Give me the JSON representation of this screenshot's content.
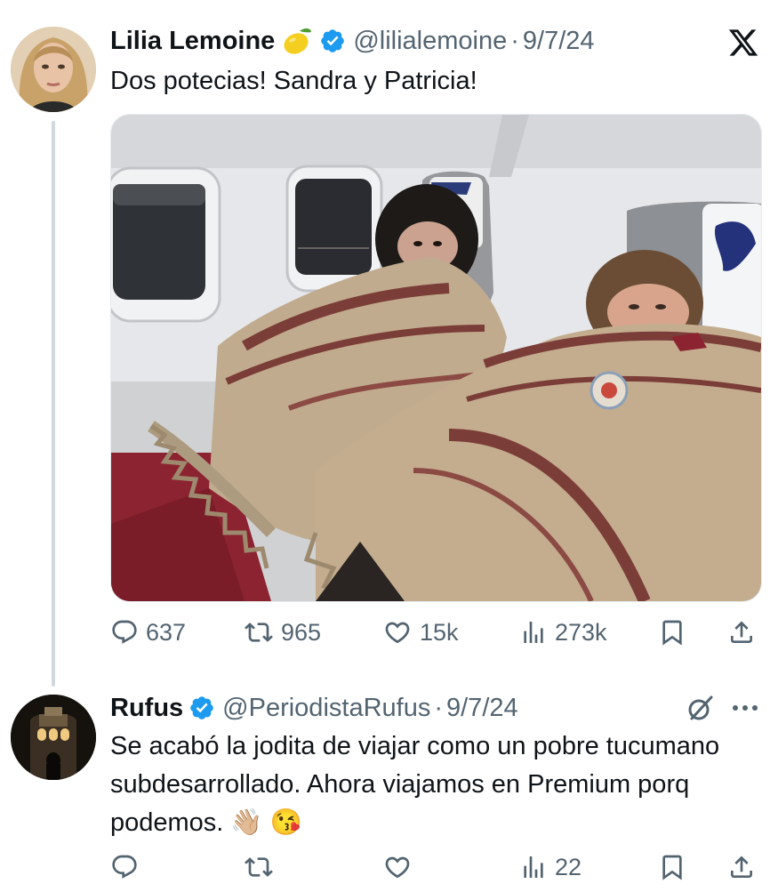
{
  "tweet": {
    "author_name": "Lilia Lemoine",
    "author_emoji": "lemon",
    "handle": "@lilialemoine",
    "separator": "·",
    "date": "9/7/24",
    "text": "Dos potecias! Sandra y Patricia!",
    "stats": {
      "replies": "637",
      "reposts": "965",
      "likes": "15k",
      "views": "273k"
    }
  },
  "reply": {
    "author_name": "Rufus",
    "handle": "@PeriodistaRufus",
    "separator": "·",
    "date": "9/7/24",
    "text": "Se acabó la jodita de viajar como un pobre tucumano subdesarrollado. Ahora viajamos en Premium porq podemos. 👋🏼 😘",
    "stats": {
      "replies": "",
      "reposts": "",
      "likes": "",
      "views": "22"
    }
  },
  "icons": {
    "platform": "x-logo",
    "verified": "verified-badge-icon",
    "reply": "reply-icon",
    "repost": "repost-icon",
    "like": "heart-icon",
    "views": "views-icon",
    "bookmark": "bookmark-icon",
    "share": "share-icon",
    "grok": "grok-icon",
    "more": "more-icon"
  },
  "colors": {
    "verified": "#1d9bf0",
    "text": "#0f1419",
    "muted": "#536471",
    "thread_line": "#cfd9de"
  }
}
